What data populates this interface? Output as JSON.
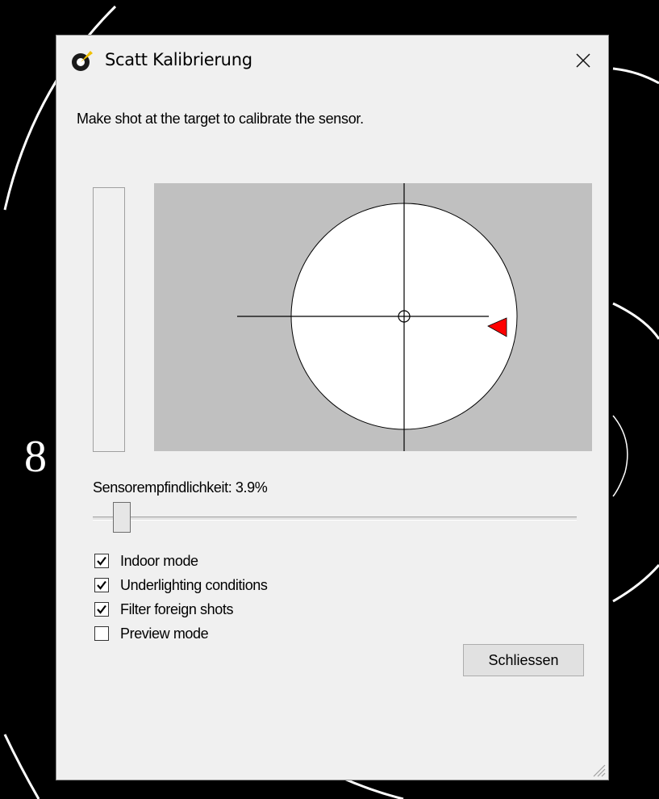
{
  "background": {
    "ring_number": "8"
  },
  "dialog": {
    "title": "Scatt Kalibrierung",
    "instruction": "Make shot at the target to calibrate the sensor.",
    "level_meter_fraction": 0.0,
    "sensitivity": {
      "label": "Sensorempfindlichkeit: 3.9%",
      "value_fraction": 0.06
    },
    "options": [
      {
        "label": "Indoor mode",
        "checked": true
      },
      {
        "label": "Underlighting conditions",
        "checked": true
      },
      {
        "label": "Filter foreign shots",
        "checked": true
      },
      {
        "label": "Preview mode",
        "checked": false
      }
    ],
    "close_button": "Schliessen",
    "colors": {
      "panel": "#c0c0c0",
      "target": "#ffffff",
      "marker": "#ff0000"
    }
  }
}
